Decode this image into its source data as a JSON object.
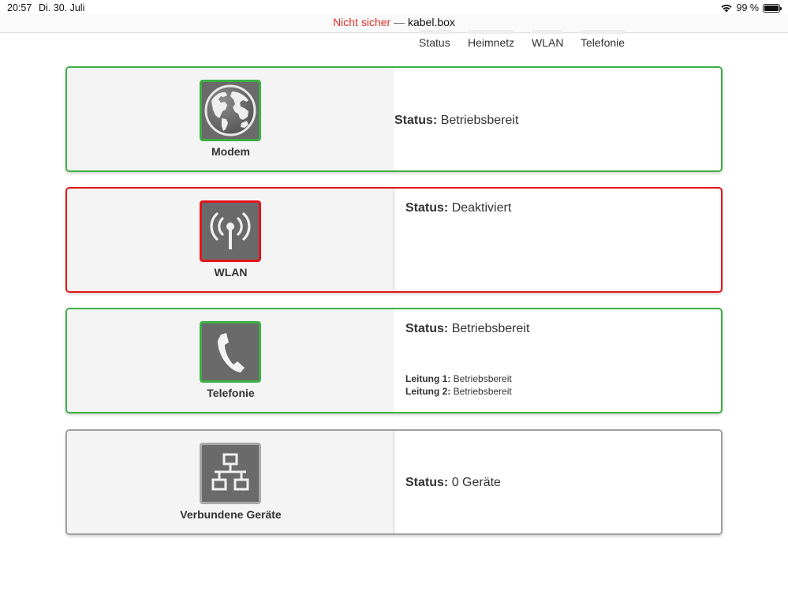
{
  "statusbar": {
    "time": "20:57",
    "date": "Di. 30. Juli",
    "battery": "99 %"
  },
  "urlbar": {
    "insecure": "Nicht sicher",
    "dash": "—",
    "host": "kabel.box"
  },
  "nav": [
    {
      "label": "Status"
    },
    {
      "label": "Heimnetz"
    },
    {
      "label": "WLAN"
    },
    {
      "label": "Telefonie"
    }
  ],
  "cards": {
    "modem": {
      "label": "Modem",
      "status_key": "Status:",
      "status_value": "Betriebsbereit"
    },
    "wlan": {
      "label": "WLAN",
      "status_key": "Status:",
      "status_value": "Deaktiviert"
    },
    "telefonie": {
      "label": "Telefonie",
      "status_key": "Status:",
      "status_value": "Betriebsbereit",
      "lines": [
        {
          "key": "Leitung 1:",
          "value": "Betriebsbereit"
        },
        {
          "key": "Leitung 2:",
          "value": "Betriebsbereit"
        }
      ]
    },
    "geraete": {
      "label": "Verbundene Geräte",
      "status_key": "Status:",
      "status_value": "0 Geräte"
    }
  },
  "colors": {
    "ok": "#3cb043",
    "error": "#e2161b",
    "neutral": "#a0a0a0"
  },
  "icons": {
    "modem": "globe-icon",
    "wlan": "antenna-icon",
    "telefonie": "phone-icon",
    "geraete": "network-icon"
  }
}
